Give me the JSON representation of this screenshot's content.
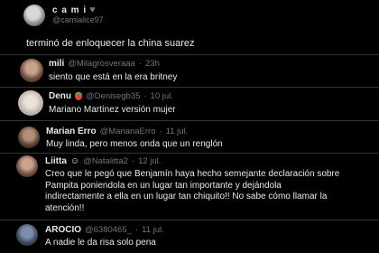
{
  "main_post": {
    "display_name": "c a m i",
    "handle": "@camialice97",
    "text": "terminó de enloquecer la china suarez"
  },
  "replies": [
    {
      "name": "mili",
      "handle": "@Milagrosveraaa",
      "sep": "·",
      "time": "23h",
      "text": "siento que está en la era britney"
    },
    {
      "name": "Denu",
      "handle": "@Denisegb35",
      "sep": "·",
      "time": "10 jul.",
      "text": "Mariano Martínez versión mujer"
    },
    {
      "name": "Marian Erro",
      "handle": "@MarianaErro",
      "sep": "·",
      "time": "11 jul.",
      "text": "Muy linda, pero menos onda que un renglón"
    },
    {
      "name": "Liitta",
      "handle": "@Natalitta2",
      "sep": "·",
      "time": "12 jul.",
      "text_lines": [
        "Creo que le pegó que Benjamín haya hecho semejante declaración sobre",
        "Pampita poniendola en un lugar tan importante y dejándola",
        "indirectamente a ella en un lugar tan chiquito!! No sabe cómo llamar la",
        "atención!!"
      ]
    },
    {
      "name": "AROCIO",
      "handle": "@6380465_",
      "sep": "·",
      "time": "11 jul.",
      "text": "A nadie le da risa solo pena"
    }
  ],
  "colors": {
    "background": "#000000",
    "text": "#e7e9ea",
    "muted": "#71767b",
    "divider": "#2f3336"
  }
}
